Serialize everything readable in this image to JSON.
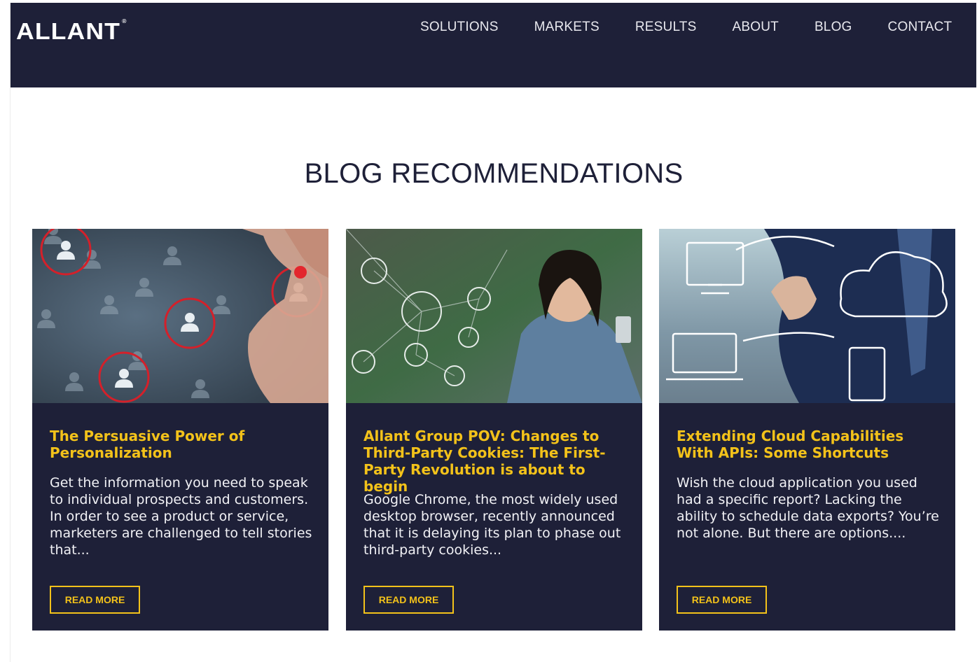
{
  "header": {
    "logo_text": "ALLANT",
    "logo_mark": "®",
    "nav": [
      "SOLUTIONS",
      "MARKETS",
      "RESULTS",
      "ABOUT",
      "BLOG",
      "CONTACT"
    ]
  },
  "section": {
    "title": "BLOG RECOMMENDATIONS"
  },
  "cards": [
    {
      "title": "The Persuasive Power of Personalization",
      "excerpt": "Get the information you need to speak to individual prospects and customers. In order to see a product or service, marketers are challenged to tell stories that...",
      "button": "READ MORE",
      "image": "personalization-people-icons-photo"
    },
    {
      "title": "Allant Group POV: Changes to Third-Party Cookies: The First-Party Revolution is about to begin",
      "excerpt": "Google Chrome, the most widely used desktop browser, recently announced that it is delaying its plan to phase out third-party cookies...",
      "button": "READ MORE",
      "image": "woman-with-phone-network-photo"
    },
    {
      "title": "Extending Cloud Capabilities With APIs: Some Shortcuts",
      "excerpt": "Wish the cloud application you used had a specific report? Lacking the ability to schedule data exports? You’re not alone. But there are options....",
      "button": "READ MORE",
      "image": "cloud-diagram-businessman-photo"
    }
  ],
  "colors": {
    "navy": "#1e2038",
    "accent_yellow": "#f3c21a",
    "white": "#ffffff"
  }
}
